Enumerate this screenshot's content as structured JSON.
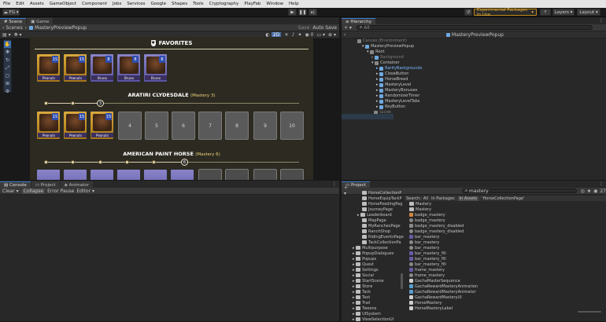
{
  "menu": [
    "File",
    "Edit",
    "Assets",
    "GameObject",
    "Component",
    "Jobs",
    "Services",
    "Google",
    "Shapes",
    "Tools",
    "Cryptography",
    "PlayFab",
    "Window",
    "Help"
  ],
  "toolbar": {
    "account": "FG",
    "experimental": "Experimental Packages In Use",
    "layers": "Layers",
    "layout": "Layout"
  },
  "scene_tabs": [
    "Scene",
    "Game"
  ],
  "scene_header": {
    "scenes_label": "Scenes",
    "prefab": "MasteryPreviewPopup",
    "save": "Save",
    "autosave": "Auto Save",
    "mode2d": "2D"
  },
  "game": {
    "favorites_title": "FAVORITES",
    "favorites_cards": [
      {
        "level": "15",
        "name": "Peanuts",
        "color": "gold"
      },
      {
        "level": "15",
        "name": "Peanuts",
        "color": "gold"
      },
      {
        "level": "8",
        "name": "Bruno",
        "color": "purple"
      },
      {
        "level": "8",
        "name": "Bruno",
        "color": "purple"
      },
      {
        "level": "8",
        "name": "Bruno",
        "color": "purple"
      }
    ],
    "breed1": {
      "name": "ARATIRI CLYDESDALE",
      "mastery": "(Mastery 3)",
      "current": "3",
      "cards": [
        {
          "level": "15",
          "name": "Peanuts"
        },
        {
          "level": "15",
          "name": "Peanuts"
        },
        {
          "level": "15",
          "name": "Peanuts"
        }
      ],
      "slots": [
        "4",
        "5",
        "6",
        "7",
        "8",
        "9",
        "10"
      ]
    },
    "breed2": {
      "name": "AMERICAN PAINT HORSE",
      "mastery": "(Mastery 6)",
      "current": "6"
    }
  },
  "hierarchy": {
    "tab": "Hierarchy",
    "search_placeholder": "All",
    "prefab_title": "MasteryPreviewPopup",
    "items": [
      {
        "label": "Canvas (Environment)",
        "depth": 0,
        "dim": true
      },
      {
        "label": "MasteryPreviewPopup",
        "depth": 1
      },
      {
        "label": "Root",
        "depth": 2
      },
      {
        "label": "Background",
        "depth": 3,
        "dim": true
      },
      {
        "label": "Container",
        "depth": 3
      },
      {
        "label": "RarityBackgrounds",
        "depth": 4,
        "sel": true
      },
      {
        "label": "CloseButton",
        "depth": 4
      },
      {
        "label": "HorseBreed",
        "depth": 4
      },
      {
        "label": "MasteryLevel",
        "depth": 4
      },
      {
        "label": "MasteryBonuses",
        "depth": 4
      },
      {
        "label": "RandomizerTimer",
        "depth": 4
      },
      {
        "label": "MasteryLevelTabs",
        "depth": 4
      },
      {
        "label": "KeyButton",
        "depth": 4
      },
      {
        "label": "Guide",
        "depth": 3,
        "dim": true
      }
    ]
  },
  "console": {
    "tabs": [
      "Console",
      "Project",
      "Animator"
    ],
    "clear": "Clear",
    "collapse": "Collapse",
    "error_pause": "Error Pause",
    "editor": "Editor"
  },
  "project": {
    "tab": "Project",
    "search_value": "mastery",
    "search_label": "Search:",
    "scope_all": "All",
    "scope_packages": "In Packages",
    "scope_assets": "In Assets",
    "scope_folder": "'HorseCollectionPage'",
    "count": "27",
    "folders": [
      "HorseCollectionP",
      "HorseEquipTackP",
      "HorseFeedingPag",
      "JourneyPage",
      "Leaderboard",
      "MapPage",
      "MyRanchesPage",
      "RanchShop",
      "RidingEventsPage",
      "TackCollectionPa",
      "Multipurpose",
      "PopupDialogues",
      "Popups",
      "Quest",
      "Settings",
      "Social",
      "StartScene",
      "Store",
      "Tack",
      "Text",
      "Trail",
      "Tweens",
      "UISystem",
      "ViewSelectionUI",
      "WorldStore"
    ],
    "assets": [
      "Mastery",
      "Mastery",
      "badge_mastery",
      "badge_mastery",
      "badge_mastery_disabled",
      "badge_mastery_disabled",
      "bar_mastery",
      "bar_mastery",
      "bar_mastery",
      "bar_mastery_fill",
      "bar_mastery_fill",
      "bar_mastery_fill",
      "frame_mastery",
      "frame_mastery",
      "GachaMasterSequence",
      "GachaRewardMasteryAnimation",
      "GachaRewardMasteryAnimator",
      "GachaRewardMasteryUI",
      "HorseMastery",
      "HorseMasteryLabel"
    ]
  }
}
